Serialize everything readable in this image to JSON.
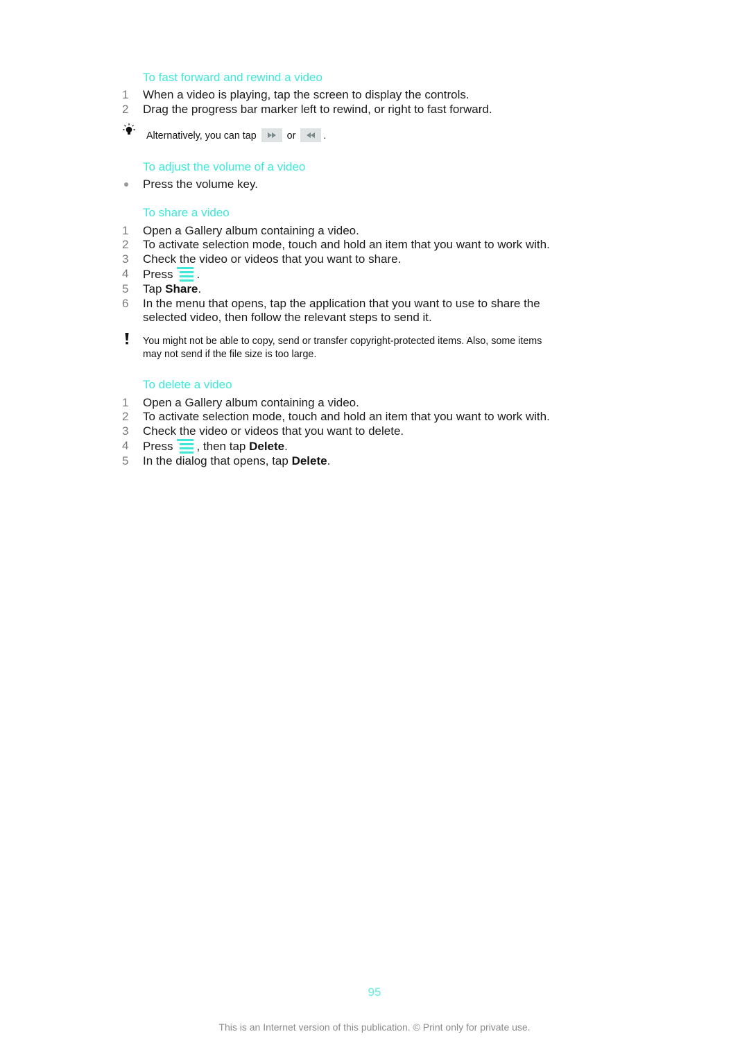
{
  "colors": {
    "accent": "#3ee8d8",
    "body_text": "#1a1a1a",
    "step_number": "#7a7a7a",
    "footer_text": "#8a8a8a"
  },
  "sections": {
    "fast_forward": {
      "title": "To fast forward and rewind a video",
      "steps": [
        {
          "num": "1",
          "text": "When a video is playing, tap the screen to display the controls."
        },
        {
          "num": "2",
          "text": "Drag the progress bar marker left to rewind, or right to fast forward."
        }
      ],
      "tip": {
        "icon": "lightbulb-icon",
        "prefix": "Alternatively, you can tap",
        "mid": "or",
        "suffix": "."
      }
    },
    "volume": {
      "title": "To adjust the volume of a video",
      "bullets": [
        "Press the volume key."
      ]
    },
    "share": {
      "title": "To share a video",
      "steps": [
        {
          "num": "1",
          "text": "Open a Gallery album containing a video."
        },
        {
          "num": "2",
          "text": "To activate selection mode, touch and hold an item that you want to work with."
        },
        {
          "num": "3",
          "text": "Check the video or videos that you want to share."
        },
        {
          "num": "4",
          "prefix": "Press",
          "suffix": "."
        },
        {
          "num": "5",
          "prefix": "Tap ",
          "bold": "Share",
          "suffix": "."
        },
        {
          "num": "6",
          "text": "In the menu that opens, tap the application that you want to use to share the",
          "text2": "selected video, then follow the relevant steps to send it."
        }
      ],
      "warning": {
        "icon": "exclamation-icon",
        "line1": "You might not be able to copy, send or transfer copyright-protected items. Also, some items",
        "line2": "may not send if the file size is too large."
      }
    },
    "delete": {
      "title": "To delete a video",
      "steps": [
        {
          "num": "1",
          "text": "Open a Gallery album containing a video."
        },
        {
          "num": "2",
          "text": "To activate selection mode, touch and hold an item that you want to work with."
        },
        {
          "num": "3",
          "text": "Check the video or videos that you want to delete."
        },
        {
          "num": "4",
          "prefix": "Press",
          "suffix": ", then tap ",
          "bold": "Delete",
          "suffix2": "."
        },
        {
          "num": "5",
          "prefix": "In the dialog that opens, tap ",
          "bold": "Delete",
          "suffix": "."
        }
      ]
    }
  },
  "footer": {
    "page_number": "95",
    "notice": "This is an Internet version of this publication. © Print only for private use."
  }
}
